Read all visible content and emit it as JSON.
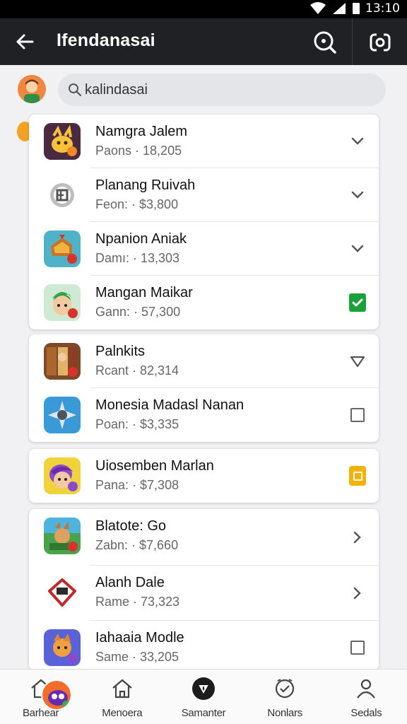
{
  "status_bar": {
    "time": "13:10"
  },
  "app_bar": {
    "title": "Ifendanasai"
  },
  "search": {
    "value": "kalindasai"
  },
  "rows": [
    {
      "name": "Namgra Jalem",
      "meta": "Paons · 18,205",
      "control": "chevron-down"
    },
    {
      "name": "Planang Ruivah",
      "meta": "Feon: · $3,800",
      "control": "chevron-down"
    },
    {
      "name": "Npanion Aniak",
      "meta": "Damı: · 13,303",
      "control": "chevron-down"
    },
    {
      "name": "Mangan Maikar",
      "meta": "Gann: · 57,300",
      "control": "checked"
    },
    {
      "name": "Palnkits",
      "meta": "Rcant · 82,314",
      "control": "heart"
    },
    {
      "name": "Monesia Madasl Nanan",
      "meta": "Poan: · $3,335",
      "control": "unchecked"
    },
    {
      "name": "Uiosemben Marlan",
      "meta": "Pana: · $7,308",
      "control": "partial"
    },
    {
      "name": "Blatote: Go",
      "meta": "Zabn: · $7,660",
      "control": "chevron-right"
    },
    {
      "name": "Alanh Dale",
      "meta": "Rame · 73,323",
      "control": "chevron-right"
    },
    {
      "name": "Iahaaia Modle",
      "meta": "Same · 33,205",
      "control": "unchecked"
    }
  ],
  "bottom_nav": [
    {
      "label": "Barhear",
      "icon": "home-icon"
    },
    {
      "label": "Menoera",
      "icon": "house-icon"
    },
    {
      "label": "Samanter",
      "icon": "compass-icon"
    },
    {
      "label": "Nonlars",
      "icon": "clock-icon"
    },
    {
      "label": "Sedals",
      "icon": "person-icon"
    }
  ],
  "colors": {
    "app_bar": "#202124",
    "check_green": "#1aa13a",
    "check_yellow": "#f3b300",
    "badge_red": "#d8322a"
  }
}
